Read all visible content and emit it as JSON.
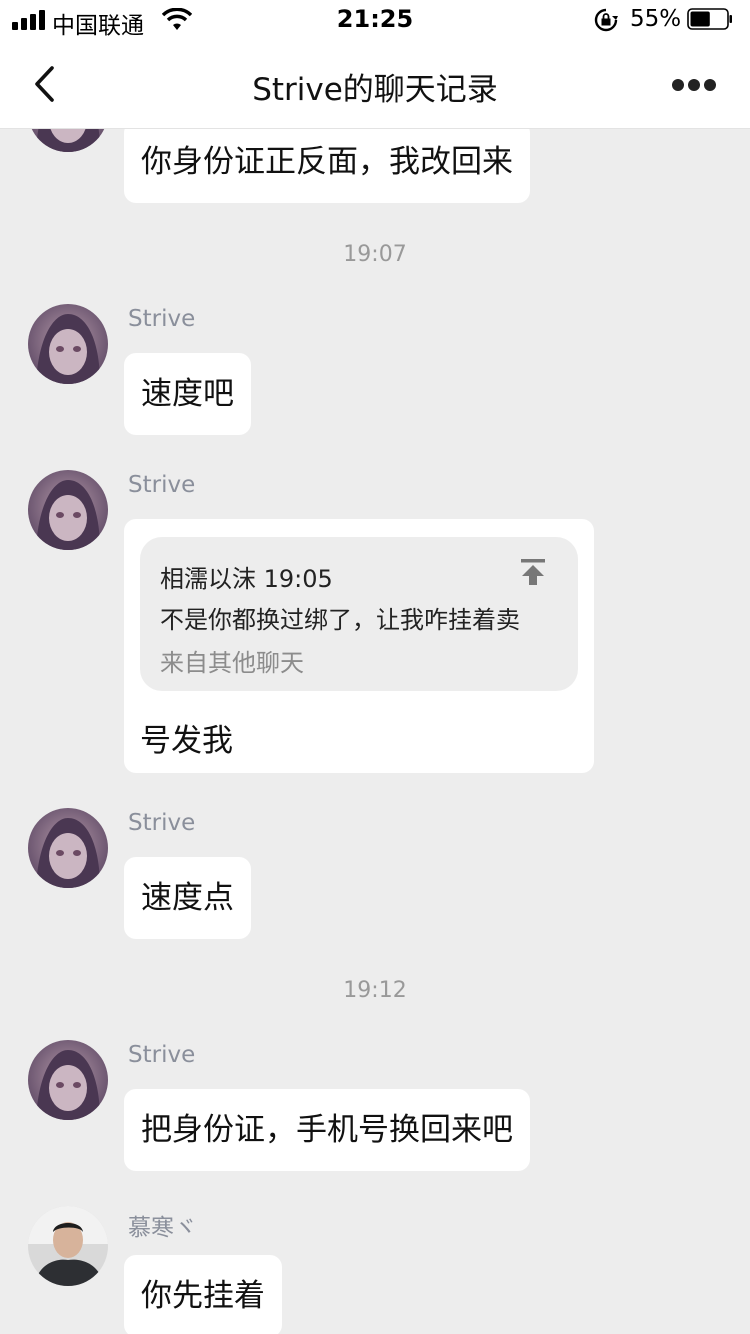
{
  "status_bar": {
    "carrier": "中国联通",
    "time": "21:25",
    "battery_percent": "55%",
    "battery_level": 0.55
  },
  "nav": {
    "title": "Strive的聊天记录"
  },
  "messages": [
    {
      "text": "你身份证正反面，我改回来"
    },
    {
      "timestamp": "19:07"
    },
    {
      "sender": "Strive",
      "text": "速度吧"
    },
    {
      "sender": "Strive",
      "quote": {
        "header": "相濡以沫 19:05",
        "text": "不是你都换过绑了，让我咋挂着卖",
        "source": "来自其他聊天"
      },
      "text": "号发我"
    },
    {
      "sender": "Strive",
      "text": "速度点"
    },
    {
      "timestamp": "19:12"
    },
    {
      "sender": "Strive",
      "text": "把身份证，手机号换回来吧"
    },
    {
      "sender": "慕寒ヾ",
      "text": "你先挂着"
    }
  ],
  "icons": [
    "signal-icon",
    "wifi-icon",
    "rotation-lock-icon",
    "battery-icon",
    "back-chevron-icon",
    "more-dots-icon",
    "pin-top-icon"
  ]
}
